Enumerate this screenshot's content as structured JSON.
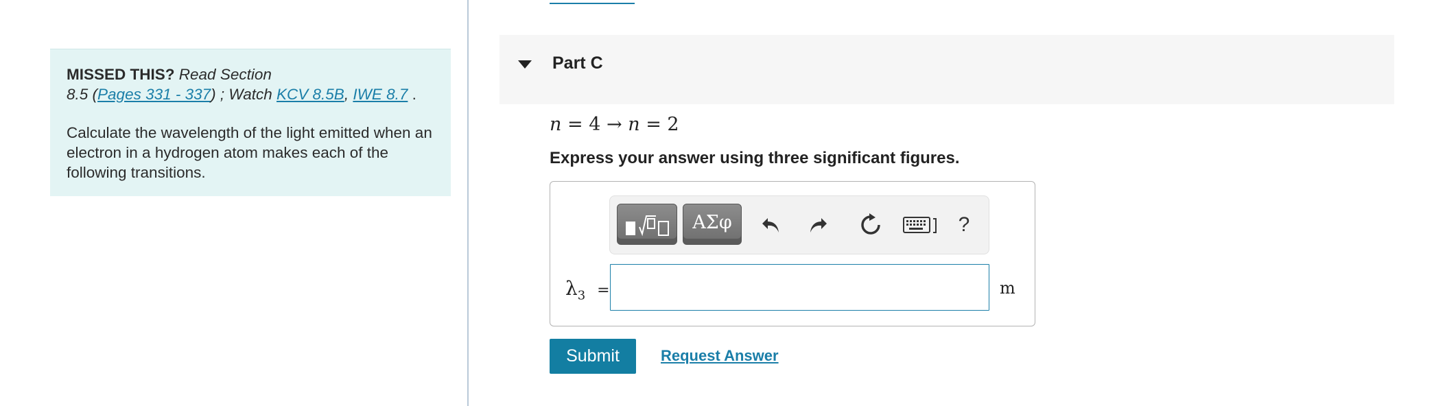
{
  "hint": {
    "missed_label": "MISSED THIS?",
    "read_section": "Read Section",
    "section_prefix": "8.5 (",
    "pages_link": "Pages 331 - 337",
    "watch_text": ") ; Watch ",
    "kcv_link": "KCV 8.5B",
    "comma": ",",
    "iwe_link": "IWE 8.7",
    "period": " .",
    "instructions": "Calculate the wavelength of the light emitted when an electron in a hydrogen atom makes each of the following transitions."
  },
  "part": {
    "title": "Part C",
    "equation": {
      "lhs_var": "n",
      "lhs_val": "4",
      "arrow": "→",
      "rhs_var": "n",
      "rhs_val": "2"
    },
    "instruction": "Express your answer using three significant figures."
  },
  "toolbar": {
    "greek_label": "ΑΣφ",
    "help_label": "?"
  },
  "answer": {
    "var_symbol": "λ",
    "var_subscript": "3",
    "equals": "=",
    "value": "",
    "unit": "m"
  },
  "actions": {
    "submit_label": "Submit",
    "request_label": "Request Answer"
  },
  "colors": {
    "accent": "#137ea2",
    "hint_bg": "#e3f4f4",
    "link": "#1a7ea8"
  }
}
